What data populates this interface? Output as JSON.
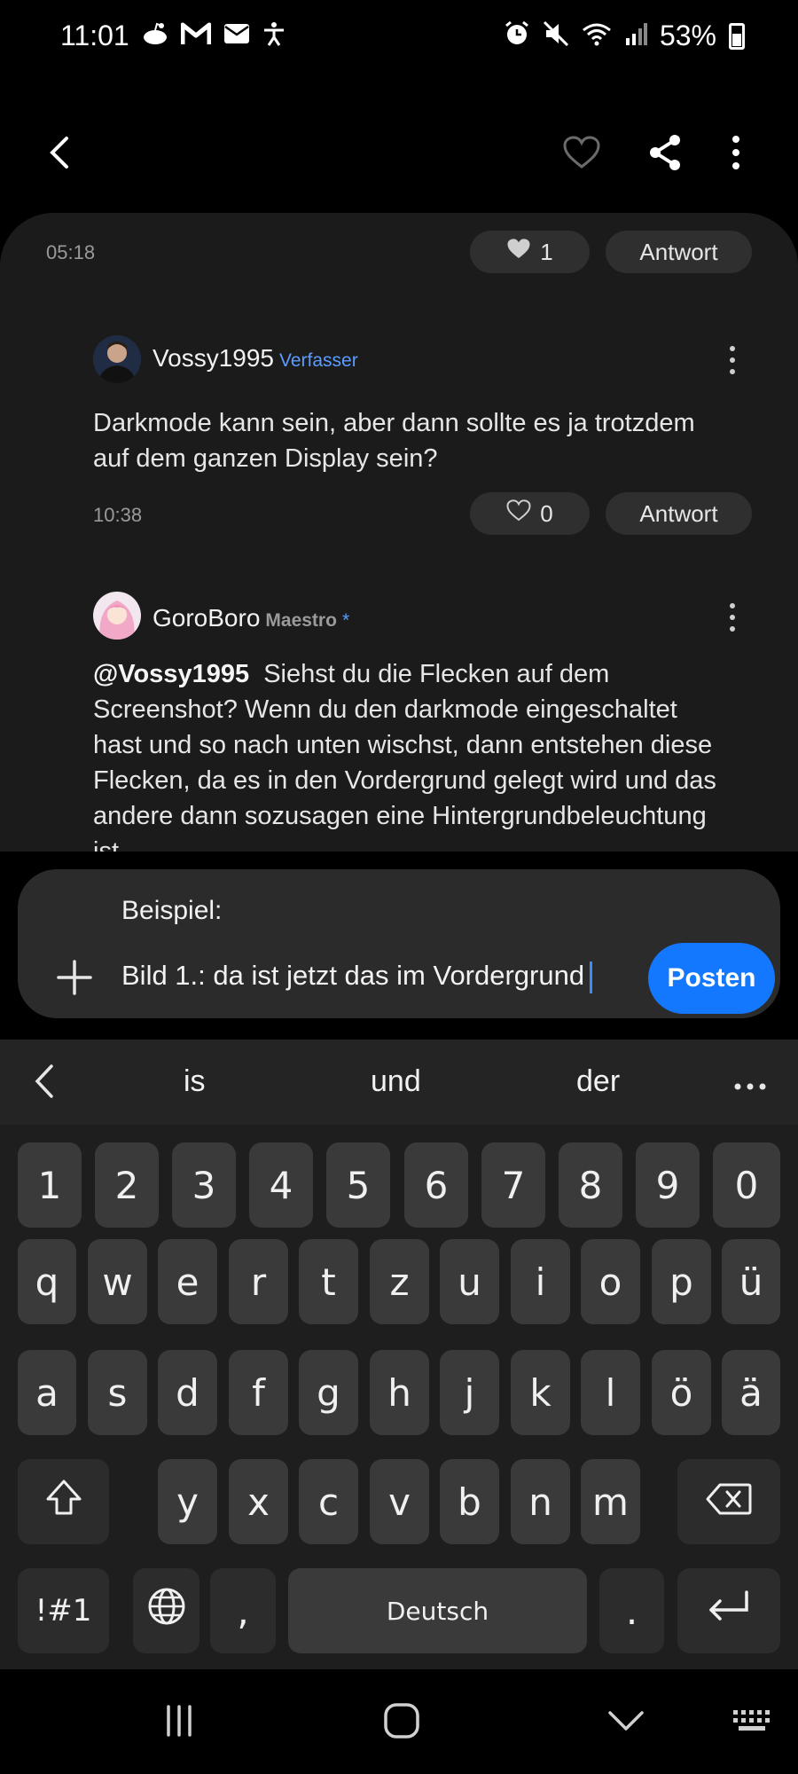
{
  "status_bar": {
    "time": "11:01",
    "battery": "53%",
    "left_icons": [
      "reddit-icon",
      "gmail-icon",
      "mail-icon",
      "accessibility-icon"
    ],
    "right_icons": [
      "alarm-icon",
      "mute-icon",
      "wifi-icon",
      "signal-icon",
      "battery-icon"
    ]
  },
  "appbar": {
    "icons": [
      "back-arrow-icon",
      "heart-outline-icon",
      "share-icon",
      "more-vertical-icon"
    ]
  },
  "thread": {
    "prev_post": {
      "timestamp": "05:18",
      "likes": "1",
      "reply_label": "Antwort"
    },
    "comments": [
      {
        "username": "Vossy1995",
        "badge": "Verfasser",
        "text": "Darkmode kann sein, aber dann sollte es ja trotzdem auf dem ganzen Display sein?",
        "lines": [
          "Darkmode kann sein, aber dann sollte es ja trotzdem",
          "auf dem ganzen Display sein?"
        ],
        "timestamp": "10:38",
        "likes": "0",
        "reply_label": "Antwort"
      },
      {
        "username": "GoroBoro",
        "rank": "Maestro",
        "star": "*",
        "mention": "@Vossy1995",
        "lines": [
          "Siehst du die Flecken auf dem",
          "Screenshot? Wenn du den darkmode eingeschaltet",
          "hast und so nach unten wischst, dann entstehen diese",
          "Flecken, da es in den Vordergrund gelegt wird und das",
          "andere dann sozusagen eine Hintergrundbeleuchtung",
          "ist"
        ]
      }
    ]
  },
  "composer": {
    "quote_line": "Beispiel:",
    "input_value": "Bild 1.: da ist jetzt das im Vordergrund",
    "post_label": "Posten"
  },
  "keyboard": {
    "suggestions": [
      "is",
      "und",
      "der"
    ],
    "row_numbers": [
      "1",
      "2",
      "3",
      "4",
      "5",
      "6",
      "7",
      "8",
      "9",
      "0"
    ],
    "row1": [
      "q",
      "w",
      "e",
      "r",
      "t",
      "z",
      "u",
      "i",
      "o",
      "p",
      "ü"
    ],
    "row2": [
      "a",
      "s",
      "d",
      "f",
      "g",
      "h",
      "j",
      "k",
      "l",
      "ö",
      "ä"
    ],
    "row3": [
      "y",
      "x",
      "c",
      "v",
      "b",
      "n",
      "m"
    ],
    "symbols_label": "!#1",
    "comma": ",",
    "space_label": "Deutsch",
    "period": "."
  },
  "nav_bar": {
    "icons": [
      "recents-icon",
      "home-icon",
      "hide-keyboard-icon",
      "keyboard-icon"
    ]
  }
}
